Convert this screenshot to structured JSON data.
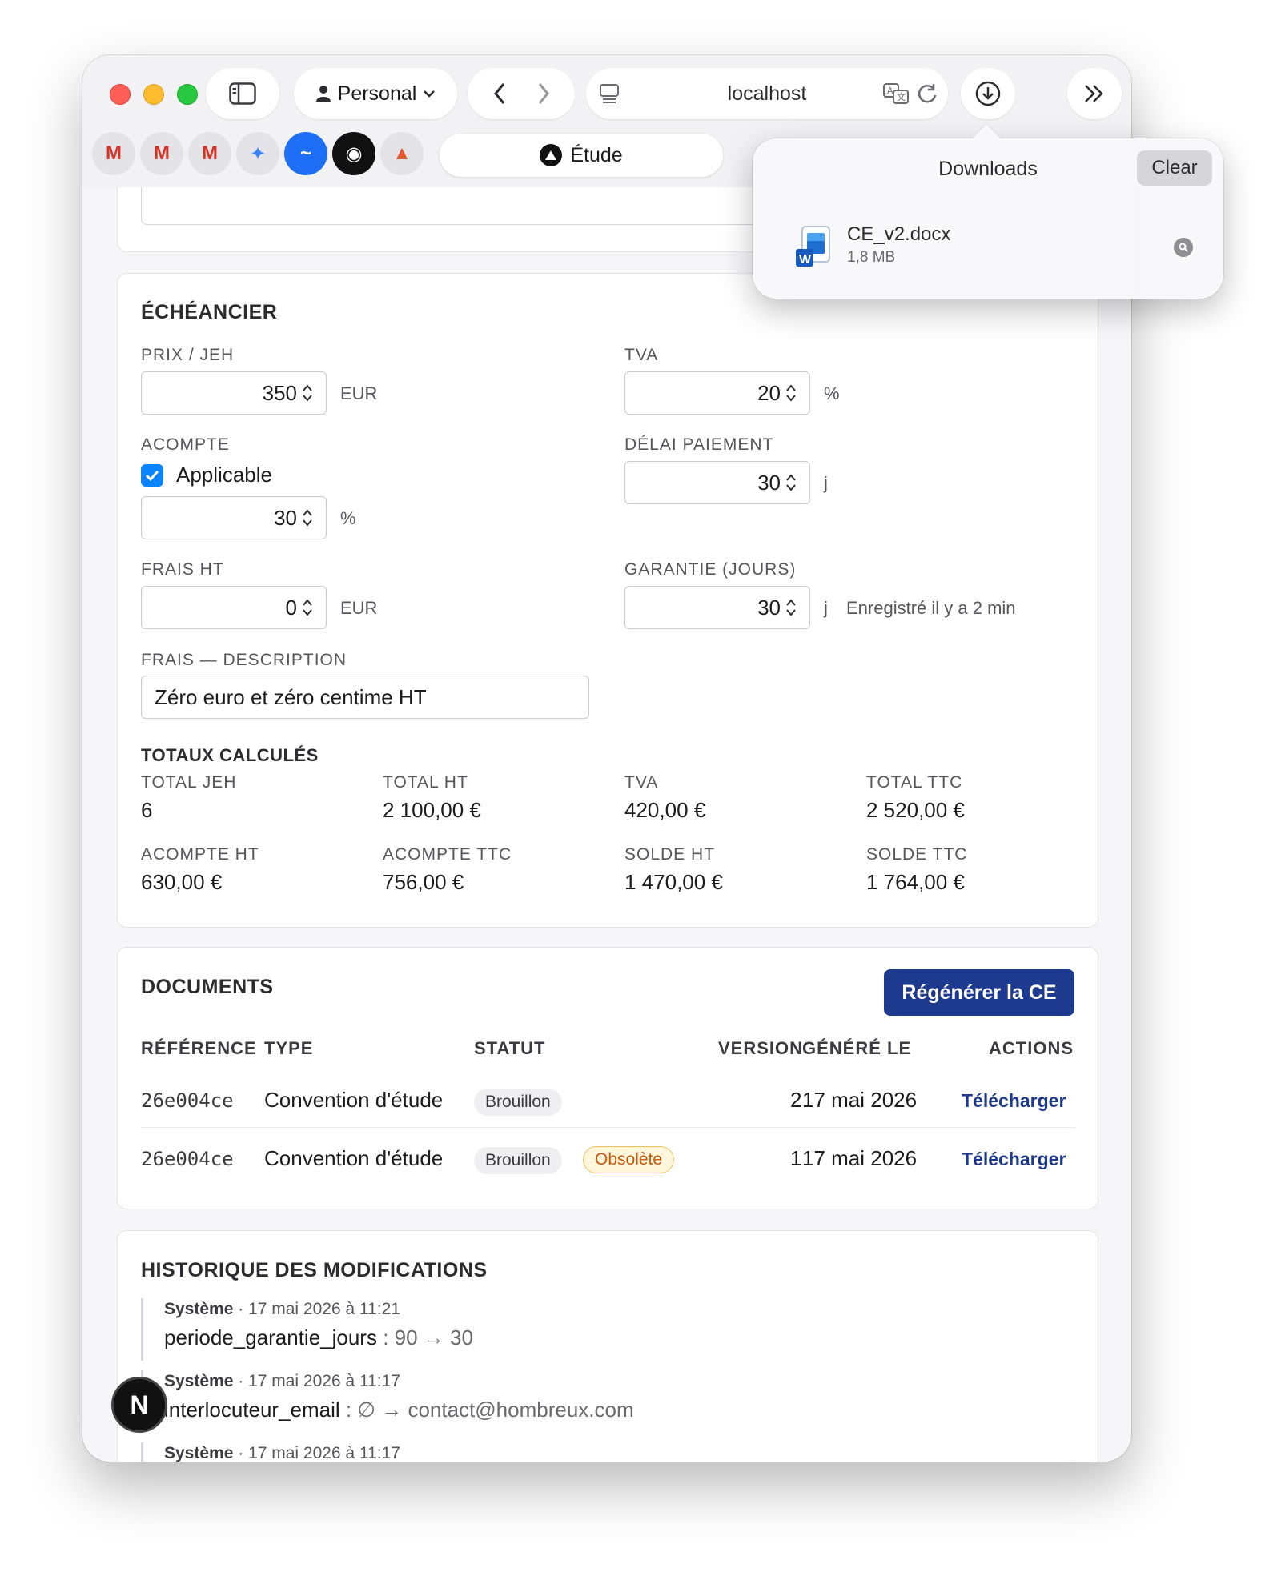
{
  "browser": {
    "profile_label": "Personal",
    "url": "localhost",
    "active_tab": "Étude",
    "favicons": [
      "M",
      "M",
      "M",
      "✦",
      "~",
      "◉",
      "▲"
    ]
  },
  "downloads": {
    "title": "Downloads",
    "clear_label": "Clear",
    "file_name": "CE_v2.docx",
    "file_size": "1,8 MB"
  },
  "echeancier": {
    "title": "ÉCHÉANCIER",
    "prix_label": "PRIX / JEH",
    "prix_value": "350",
    "prix_unit": "EUR",
    "tva_label": "TVA",
    "tva_value": "20",
    "tva_unit": "%",
    "acompte_label": "ACOMPTE",
    "acompte_check_label": "Applicable",
    "acompte_value": "30",
    "acompte_unit": "%",
    "delai_label": "DÉLAI PAIEMENT",
    "delai_value": "30",
    "delai_unit": "j",
    "frais_label": "FRAIS HT",
    "frais_value": "0",
    "frais_unit": "EUR",
    "garantie_label": "GARANTIE (JOURS)",
    "garantie_value": "30",
    "garantie_unit": "j",
    "saved_note": "Enregistré il y a 2 min",
    "frais_desc_label": "FRAIS — DESCRIPTION",
    "frais_desc_value": "Zéro euro et zéro centime HT"
  },
  "totaux": {
    "title": "TOTAUX CALCULÉS",
    "items": [
      {
        "label": "TOTAL JEH",
        "value": "6"
      },
      {
        "label": "TOTAL HT",
        "value": "2 100,00 €"
      },
      {
        "label": "TVA",
        "value": "420,00 €"
      },
      {
        "label": "TOTAL TTC",
        "value": "2 520,00 €"
      },
      {
        "label": "ACOMPTE HT",
        "value": "630,00 €"
      },
      {
        "label": "ACOMPTE TTC",
        "value": "756,00 €"
      },
      {
        "label": "SOLDE HT",
        "value": "1 470,00 €"
      },
      {
        "label": "SOLDE TTC",
        "value": "1 764,00 €"
      }
    ]
  },
  "documents": {
    "title": "DOCUMENTS",
    "regen_button": "Régénérer la CE",
    "headers": {
      "reference": "RÉFÉRENCE",
      "type": "TYPE",
      "statut": "STATUT",
      "version": "VERSION",
      "genere": "GÉNÉRÉ LE",
      "actions": "ACTIONS"
    },
    "rows": [
      {
        "reference": "26e004ce",
        "type": "Convention d'étude",
        "statut": "Brouillon",
        "obsolete": "",
        "version": "2",
        "date": "17 mai 2026",
        "action": "Télécharger"
      },
      {
        "reference": "26e004ce",
        "type": "Convention d'étude",
        "statut": "Brouillon",
        "obsolete": "Obsolète",
        "version": "1",
        "date": "17 mai 2026",
        "action": "Télécharger"
      }
    ]
  },
  "historique": {
    "title": "HISTORIQUE DES MODIFICATIONS",
    "entries": [
      {
        "author": "Système",
        "time": " · 17 mai 2026 à 11:21",
        "field": "periode_garantie_jours",
        "change": " : 90 → 30"
      },
      {
        "author": "Système",
        "time": " · 17 mai 2026 à 11:17",
        "field": "interlocuteur_email",
        "change": " : ∅ → contact@hombreux.com"
      },
      {
        "author": "Système",
        "time": " · 17 mai 2026 à 11:17",
        "field": "",
        "change": ""
      }
    ]
  },
  "dev_badge": "N"
}
